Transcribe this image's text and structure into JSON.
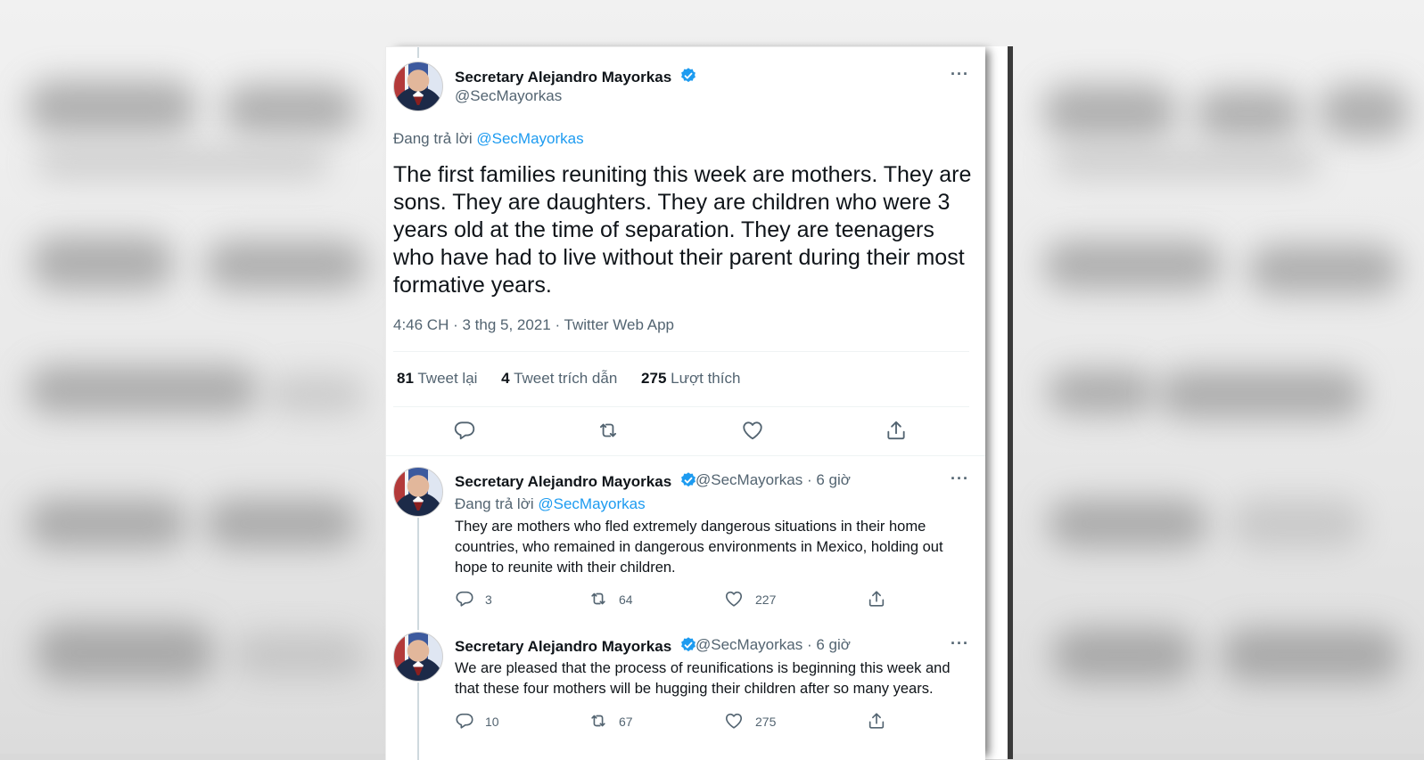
{
  "main_tweet": {
    "author_name": "Secretary Alejandro Mayorkas",
    "author_handle": "@SecMayorkas",
    "replying_label": "Đang trả lời",
    "replying_to": "@SecMayorkas",
    "text": "The first families reuniting this week are mothers. They are sons. They are daughters. They are children who were 3 years old at the time of separation. They are teenagers who have had to live without their parent during their most formative years.",
    "meta": "4:46 CH · 3 thg 5, 2021 · Twitter Web App",
    "stats": {
      "retweets_count": "81",
      "retweets_label": "Tweet lại",
      "quotes_count": "4",
      "quotes_label": "Tweet trích dẫn",
      "likes_count": "275",
      "likes_label": "Lượt thích"
    },
    "more_label": "···"
  },
  "replies": [
    {
      "author_name": "Secretary Alejandro Mayorkas",
      "handle_time": "@SecMayorkas · 6 giờ",
      "replying_label": "Đang trả lời",
      "replying_to": "@SecMayorkas",
      "text": "They are mothers who fled extremely dangerous situations in their home countries, who remained in dangerous environments in Mexico, holding out hope to reunite with their children.",
      "reply_count": "3",
      "retweet_count": "64",
      "like_count": "227",
      "more_label": "···"
    },
    {
      "author_name": "Secretary Alejandro Mayorkas",
      "handle_time": "@SecMayorkas · 6 giờ",
      "text": "We are pleased that the process of reunifications is beginning this week and that these four mothers will be hugging their children after so many years.",
      "reply_count": "10",
      "retweet_count": "67",
      "like_count": "275",
      "more_label": "···"
    }
  ],
  "colors": {
    "verified": "#1d9bf0",
    "text_primary": "#0f1419",
    "text_secondary": "#536471",
    "link": "#1d9bf0"
  },
  "icons": [
    "reply-icon",
    "retweet-icon",
    "like-icon",
    "share-icon",
    "verified-badge-icon",
    "more-icon"
  ]
}
